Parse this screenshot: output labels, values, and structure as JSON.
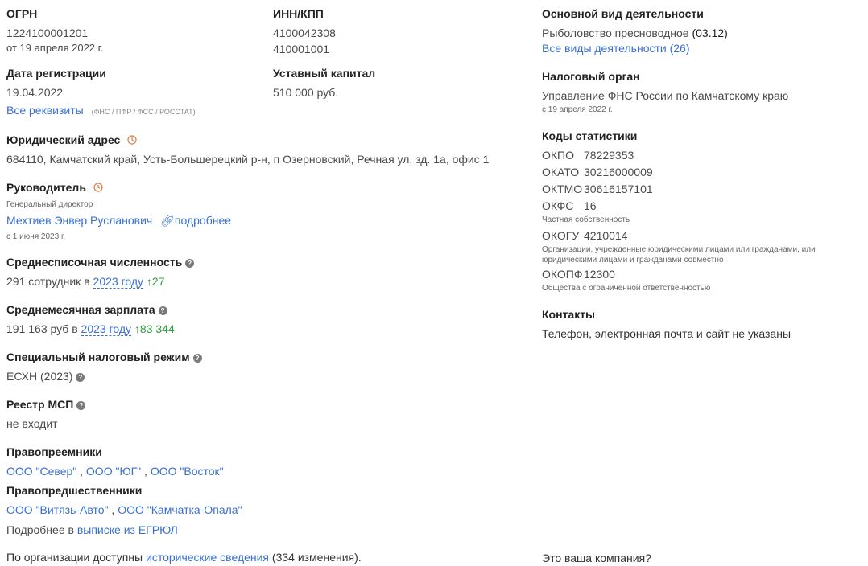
{
  "col1": {
    "ogrn": {
      "label": "ОГРН",
      "value": "1224100001201",
      "date": "от 19 апреля 2022 г."
    },
    "reg": {
      "label": "Дата регистрации",
      "value": "19.04.2022",
      "link": "Все реквизиты",
      "sources": "(ФНС / ПФР / ФСС / РОССТАТ)"
    },
    "address": {
      "label": "Юридический адрес",
      "value": "684110, Камчатский край, Усть-Большерецкий р-н, п Озерновский, Речная ул, зд. 1а, офис 1"
    },
    "head": {
      "label": "Руководитель",
      "role": "Генеральный директор",
      "name": "Мехтиев Энвер Русланович",
      "more": "подробнее",
      "since": "с 1 июня 2023 г."
    },
    "staff": {
      "label": "Среднесписочная численность",
      "prefix": "291 сотрудник в",
      "year": "2023 году",
      "delta": "↑27"
    },
    "salary": {
      "label": "Среднемесячная зарплата",
      "prefix": "191 163 руб в",
      "year": "2023 году",
      "delta": "↑83 344"
    },
    "tax": {
      "label": "Специальный налоговый режим",
      "value": "ЕСХН (2023)"
    },
    "msp": {
      "label": "Реестр МСП",
      "value": "не входит"
    },
    "successors": {
      "label": "Правопреемники",
      "items": [
        "ООО \"Север\"",
        "ООО \"ЮГ\"",
        "ООО \"Восток\""
      ]
    },
    "predecessors": {
      "label": "Правопредшественники",
      "items": [
        "ООО \"Витязь-Авто\"",
        "ООО \"Камчатка-Опала\""
      ]
    },
    "extract": {
      "prefix": "Подробнее в",
      "link": "выписке из ЕГРЮЛ"
    },
    "history": {
      "prefix": "По организации доступны",
      "link": "исторические сведения",
      "suffix": "(334 изменения)."
    }
  },
  "col2": {
    "inn": {
      "label": "ИНН/КПП",
      "inn": "4100042308",
      "kpp": "410001001"
    },
    "capital": {
      "label": "Уставный капитал",
      "value": "510 000 руб."
    }
  },
  "col3": {
    "activity": {
      "label": "Основной вид деятельности",
      "value": "Рыболовство пресноводное",
      "code": "(03.12)",
      "link": "Все виды деятельности (26)"
    },
    "taxorg": {
      "label": "Налоговый орган",
      "value": "Управление ФНС России по Камчатскому краю",
      "date": "с 19 апреля 2022 г."
    },
    "stats": {
      "label": "Коды статистики",
      "okpo": {
        "k": "ОКПО",
        "v": "78229353"
      },
      "okato": {
        "k": "ОКАТО",
        "v": "30216000009"
      },
      "oktmo": {
        "k": "ОКТМО",
        "v": "30616157101"
      },
      "okfs": {
        "k": "ОКФС",
        "v": "16",
        "note": "Частная собственность"
      },
      "okogu": {
        "k": "ОКОГУ",
        "v": "4210014",
        "note1": "Организации, учрежденные юридическими лицами или гражданами, или",
        "note2": "юридическими лицами и гражданами совместно"
      },
      "okopf": {
        "k": "ОКОПФ",
        "v": "12300",
        "note": "Общества с ограниченной ответственностью"
      }
    },
    "contacts": {
      "label": "Контакты",
      "value": "Телефон, электронная почта и сайт не указаны"
    },
    "owner": "Это ваша компания?"
  }
}
